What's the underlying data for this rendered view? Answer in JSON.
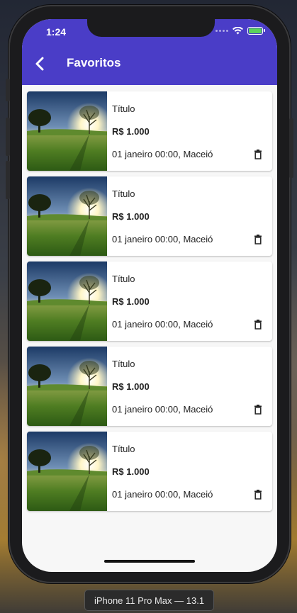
{
  "status": {
    "time": "1:24"
  },
  "appbar": {
    "title": "Favoritos",
    "back_icon": "chevron-left-icon"
  },
  "items": [
    {
      "title": "Título",
      "price": "R$ 1.000",
      "date": "01 janeiro 00:00, Maceió"
    },
    {
      "title": "Título",
      "price": "R$ 1.000",
      "date": "01 janeiro 00:00, Maceió"
    },
    {
      "title": "Título",
      "price": "R$ 1.000",
      "date": "01 janeiro 00:00, Maceió"
    },
    {
      "title": "Título",
      "price": "R$ 1.000",
      "date": "01 janeiro 00:00, Maceió"
    },
    {
      "title": "Título",
      "price": "R$ 1.000",
      "date": "01 janeiro 00:00, Maceió"
    }
  ],
  "device": {
    "label": "iPhone 11 Pro Max — 13.1"
  },
  "colors": {
    "appbar": "#4a3dc7",
    "background": "#f7f7f7",
    "battery": "#5bd35b"
  }
}
